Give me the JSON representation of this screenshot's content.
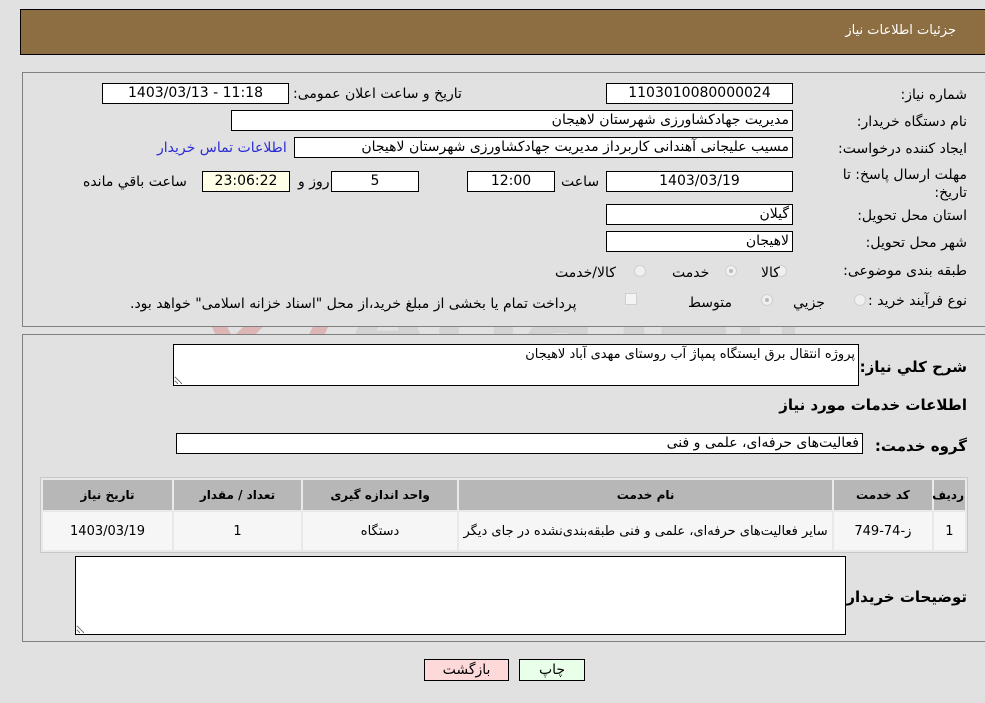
{
  "header": {
    "title": "جزئیات اطلاعات نیاز"
  },
  "form": {
    "need_number": {
      "label": "شماره نیاز:",
      "value": "1103010080000024"
    },
    "announce_datetime": {
      "label": "تاریخ و ساعت اعلان عمومی:",
      "value": "1403/03/13 - 11:18"
    },
    "buyer_org": {
      "label": "نام دستگاه خریدار:",
      "value": "مدیریت جهادکشاورزی شهرستان لاهیجان"
    },
    "requester": {
      "label": "ایجاد کننده درخواست:",
      "value": "مسیب علیجانی آهندانی کاربرداز مدیریت جهادکشاورزی شهرستان لاهیجان"
    },
    "buyer_contact_link": "اطلاعات تماس خریدار",
    "deadline": {
      "label": "مهلت ارسال پاسخ: تا تاریخ:",
      "date": "1403/03/19",
      "time_label": "ساعت",
      "time": "12:00",
      "days": "5",
      "days_label": "روز و",
      "remaining": "23:06:22",
      "remaining_label": "ساعت باقي مانده"
    },
    "province": {
      "label": "استان محل تحویل:",
      "value": "گیلان"
    },
    "city": {
      "label": "شهر محل تحویل:",
      "value": "لاهیجان"
    },
    "category": {
      "label": "طبقه بندی موضوعی:",
      "options": [
        {
          "label": "کالا",
          "checked": false
        },
        {
          "label": "خدمت",
          "checked": true
        },
        {
          "label": "کالا/خدمت",
          "checked": false
        }
      ]
    },
    "purchase_type": {
      "label": "نوع فرآیند خرید :",
      "options": [
        {
          "label": "جزيي",
          "checked": false
        },
        {
          "label": "متوسط",
          "checked": true
        }
      ],
      "treasury_note": "پرداخت تمام یا بخشی از مبلغ خرید،از محل \"اسناد خزانه اسلامی\" خواهد بود."
    }
  },
  "details": {
    "description_label": "شرح كلي نياز:",
    "description": "پروژه انتقال برق ایستگاه پمپاژ آب روستای مهدی آباد لاهیجان",
    "services_heading": "اطلاعات خدمات مورد نیاز",
    "service_group_label": "گروه خدمت:",
    "service_group": "فعالیت‌های حرفه‌ای، علمی و فنی",
    "table": {
      "columns": [
        "ردیف",
        "کد خدمت",
        "نام خدمت",
        "واحد اندازه گیری",
        "تعداد / مقدار",
        "تاریخ نیاز"
      ],
      "rows": [
        [
          "1",
          "ز-74-749",
          "سایر فعالیت‌های حرفه‌ای، علمی و فنی طبقه‌بندی‌نشده در جای دیگر",
          "دستگاه",
          "1",
          "1403/03/19"
        ]
      ]
    },
    "buyer_notes_label": "توضیحات خریدار:",
    "buyer_notes": ""
  },
  "buttons": {
    "back": "بازگشت",
    "print": "چاپ"
  },
  "watermark": {
    "text": "AriaTender.neT"
  },
  "colors": {
    "header": "#8d6d42",
    "link": "#2b2bd6",
    "back_button": "#fdd9d9",
    "print_button": "#eaffea"
  }
}
